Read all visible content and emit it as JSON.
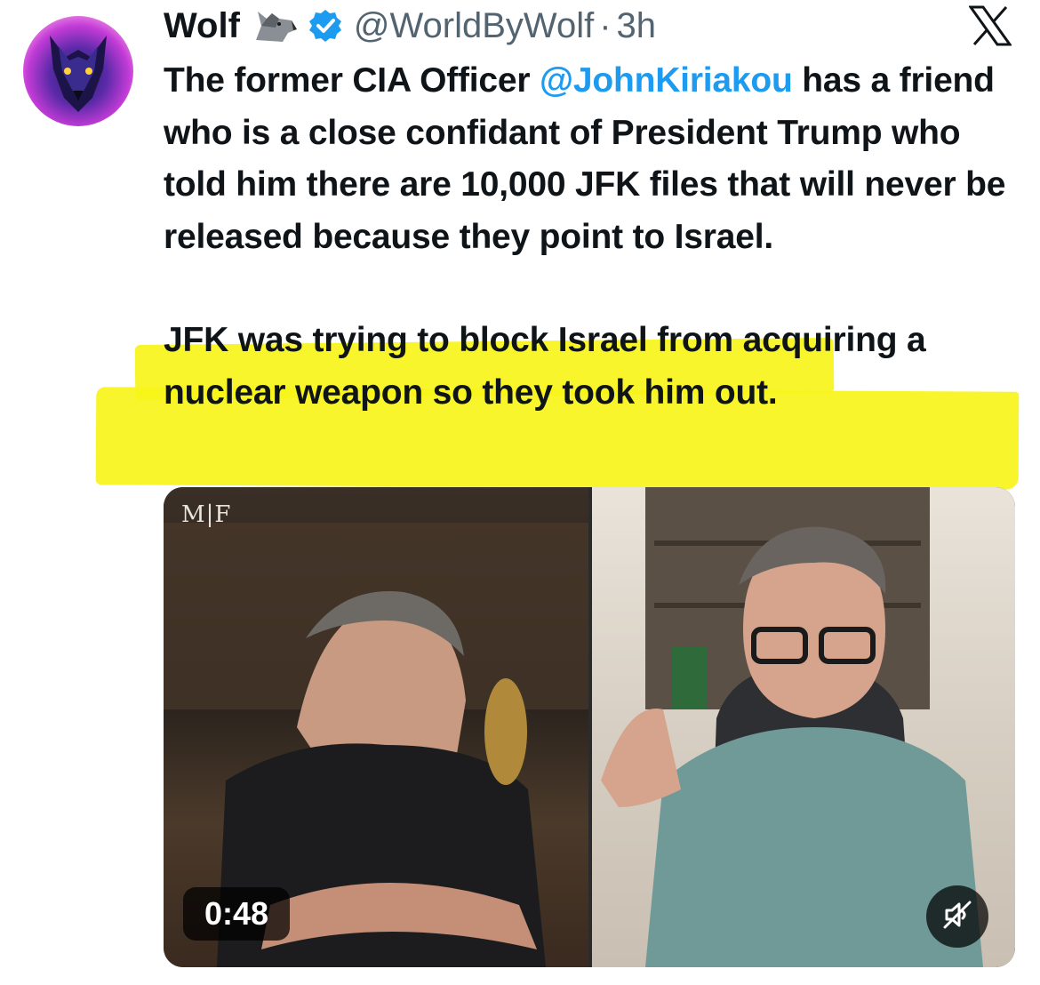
{
  "tweet": {
    "author_name": "Wolf",
    "author_emoji": "wolf-emoji-icon",
    "verified": true,
    "handle": "@WorldByWolf",
    "separator": "·",
    "time": "3h",
    "text_pre_mention": "The former CIA Officer ",
    "mention": "@JohnKiriakou",
    "text_post_mention": " has a friend who is a close confidant of President Trump who told him there are 10,000 JFK files that will never be released because they point to Israel.",
    "highlighted_text": "JFK was trying to block Israel from acquiring a nuclear weapon so they took him out.",
    "highlight_color": "#f7f41a",
    "mention_color": "#1d9bf0"
  },
  "platform": {
    "logo_icon": "x-logo-icon"
  },
  "video": {
    "watermark": "M|F",
    "duration": "0:48",
    "mute_icon": "muted-speaker-icon"
  }
}
